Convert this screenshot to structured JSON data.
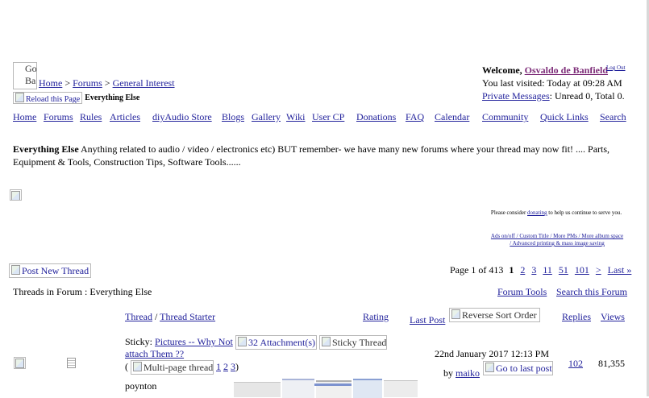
{
  "header": {
    "logo_alt_1": "Go",
    "logo_alt_2": "Ba",
    "breadcrumb": [
      "Home",
      "Forums",
      "General Interest"
    ],
    "crumb_sep": ">",
    "reload_alt": "Reload this Page",
    "forum_name": "Everything Else",
    "welcome_label": "Welcome,",
    "username": "Osvaldo de Banfield",
    "logout": "Log Out",
    "last_visited": "You last visited: Today at 09:28 AM",
    "pm_link": "Private Messages",
    "pm_status": ": Unread 0, Total 0."
  },
  "nav": [
    "Home",
    "Forums",
    "Rules",
    "Articles",
    "diyAudio Store",
    "Blogs",
    "Gallery",
    "Wiki",
    "User CP",
    "Donations",
    "FAQ",
    "Calendar",
    "Community",
    "Quick Links",
    "Search"
  ],
  "forum_desc": {
    "title": "Everything Else",
    "line1": "Anything related to audio / video / electronics etc) BUT remember- we have many new forums where your thread may now fit! .... Parts,",
    "line2": "Equipment & Tools, Construction Tips, Software Tools......"
  },
  "donate": {
    "pre": "Please consider",
    "link": "donating",
    "post": "to help us continue to serve you.",
    "links1": "Ads on/off / Custom Title / More PMs / More album space",
    "links2": "/ Advanced printing & mass image saving"
  },
  "thread_controls": {
    "new_thread_alt": "Post New Thread",
    "page_label": "Page 1 of 413",
    "pages": [
      "1",
      "2",
      "3",
      "11",
      "51",
      "101"
    ],
    "next": ">",
    "last": "Last »",
    "threads_in_forum": "Threads in Forum",
    "threads_in_forum_sep": ": Everything Else",
    "forum_tools": "Forum Tools",
    "search_forum": "Search this Forum"
  },
  "table": {
    "col_thread": "Thread",
    "col_sep": "/",
    "col_starter": "Thread Starter",
    "col_rating": "Rating",
    "col_lastpost": "Last Post",
    "sort_alt": "Reverse Sort Order",
    "col_replies": "Replies",
    "col_views": "Views"
  },
  "rows": [
    {
      "sticky_label": "Sticky:",
      "title_1": "Pictures -- Why Not",
      "title_2": "attach Them ??",
      "attach_alt": "32 Attachment(s)",
      "sticky_alt": "Sticky Thread",
      "multipage_alt": "Multi-page thread",
      "open_paren": "(",
      "pages": [
        "1",
        "2",
        "3"
      ],
      "close_paren": ")",
      "starter": "poynton",
      "last_post_date": "22nd January 2017 12:13 PM",
      "by_label": "by",
      "last_post_user": "maiko",
      "goto_alt": "Go to last post",
      "replies": "102",
      "views": "81,355"
    }
  ]
}
